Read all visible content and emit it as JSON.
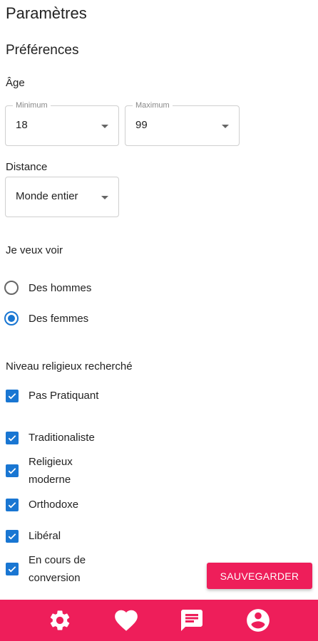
{
  "page": {
    "title": "Paramètres",
    "section_title": "Préférences"
  },
  "age": {
    "label": "Âge",
    "min_label": "Minimum",
    "min_value": "18",
    "max_label": "Maximum",
    "max_value": "99"
  },
  "distance": {
    "label": "Distance",
    "value": "Monde entier"
  },
  "see": {
    "label": "Je veux voir",
    "options": [
      {
        "label": "Des hommes",
        "selected": false
      },
      {
        "label": "Des femmes",
        "selected": true
      }
    ]
  },
  "religious": {
    "label": "Niveau religieux recherché",
    "options": [
      {
        "label": "Pas Pratiquant",
        "checked": true
      },
      {
        "label": "Traditionaliste",
        "checked": true
      },
      {
        "label": "Religieux moderne",
        "checked": true
      },
      {
        "label": "Orthodoxe",
        "checked": true
      },
      {
        "label": "Libéral",
        "checked": true
      },
      {
        "label": "En cours de conversion",
        "checked": true
      }
    ]
  },
  "actions": {
    "save_label": "SAUVEGARDER"
  },
  "nav": {
    "items": [
      {
        "icon": "gear-icon"
      },
      {
        "icon": "heart-icon"
      },
      {
        "icon": "chat-icon"
      },
      {
        "icon": "account-icon"
      }
    ]
  },
  "colors": {
    "accent": "#ee1e5a",
    "control_blue": "#1976d2"
  }
}
